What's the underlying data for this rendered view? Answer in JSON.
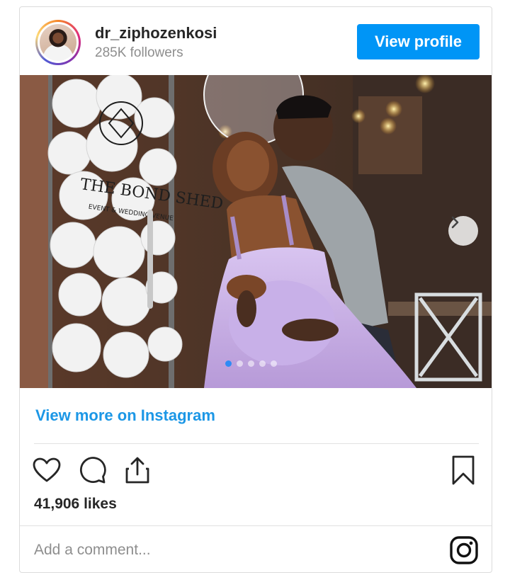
{
  "post": {
    "username": "dr_ziphozenkosi",
    "followers": "285K followers",
    "view_profile_label": "View profile",
    "photo_sign": {
      "line1": "THE BOND SHED",
      "line2": "EVENT & WEDDING VENUE"
    },
    "carousel": {
      "total": 5,
      "active_index": 0
    },
    "view_more_label": "View more on Instagram",
    "likes": "41,906 likes",
    "comment_placeholder": "Add a comment...",
    "icons": {
      "like": "heart-icon",
      "comment": "comment-icon",
      "share": "share-icon",
      "save": "bookmark-icon",
      "brand": "instagram-icon",
      "next": "chevron-right-icon"
    },
    "colors": {
      "primary": "#0095f6",
      "link": "#1c97e6",
      "text": "#262626",
      "muted": "#8e8e8e",
      "dress": "#c9b2e6"
    }
  }
}
